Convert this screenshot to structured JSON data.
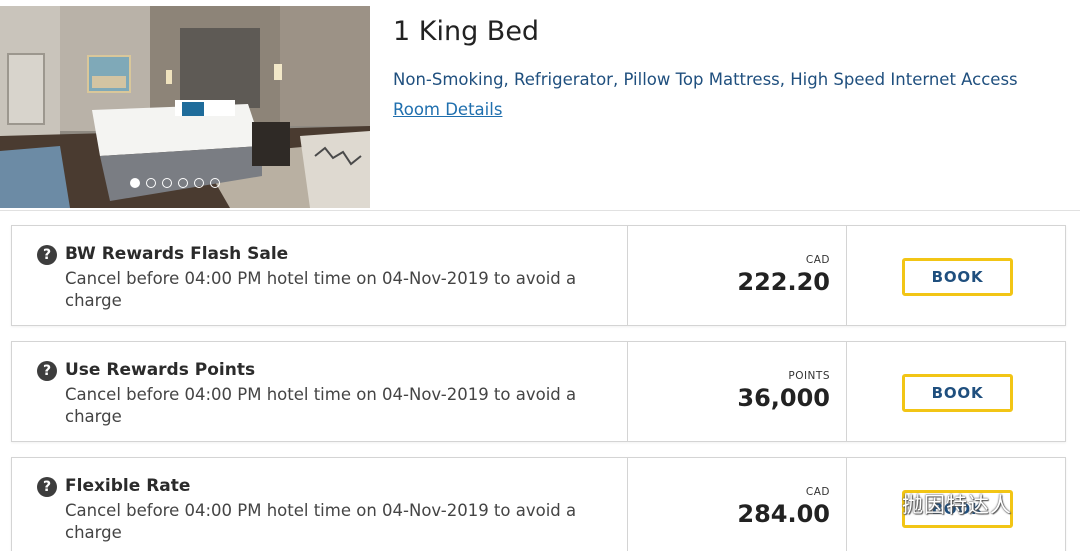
{
  "room": {
    "title": "1 King Bed",
    "amenities": "Non-Smoking, Refrigerator, Pillow Top Mattress, High Speed Internet Access",
    "details_link": "Room Details",
    "photo_count": 6,
    "active_photo_index": 0
  },
  "rates": [
    {
      "name": "BW Rewards Flash Sale",
      "policy": "Cancel before 04:00 PM hotel time on 04-Nov-2019 to avoid a charge",
      "currency": "CAD",
      "price": "222.20",
      "book_label": "BOOK"
    },
    {
      "name": "Use Rewards Points",
      "policy": "Cancel before 04:00 PM hotel time on 04-Nov-2019 to avoid a charge",
      "currency": "POINTS",
      "price": "36,000",
      "book_label": "BOOK"
    },
    {
      "name": "Flexible Rate",
      "policy": "Cancel before 04:00 PM hotel time on 04-Nov-2019 to avoid a charge",
      "currency": "CAD",
      "price": "284.00",
      "book_label": "BOOK"
    }
  ],
  "help_glyph": "?",
  "watermark": {
    "text": "抛因特达人",
    "icon": "wechat-icon"
  },
  "colors": {
    "book_border": "#f2c515",
    "book_text": "#1f4f7e",
    "link": "#1f6fae",
    "amenities": "#1f4f7e"
  }
}
